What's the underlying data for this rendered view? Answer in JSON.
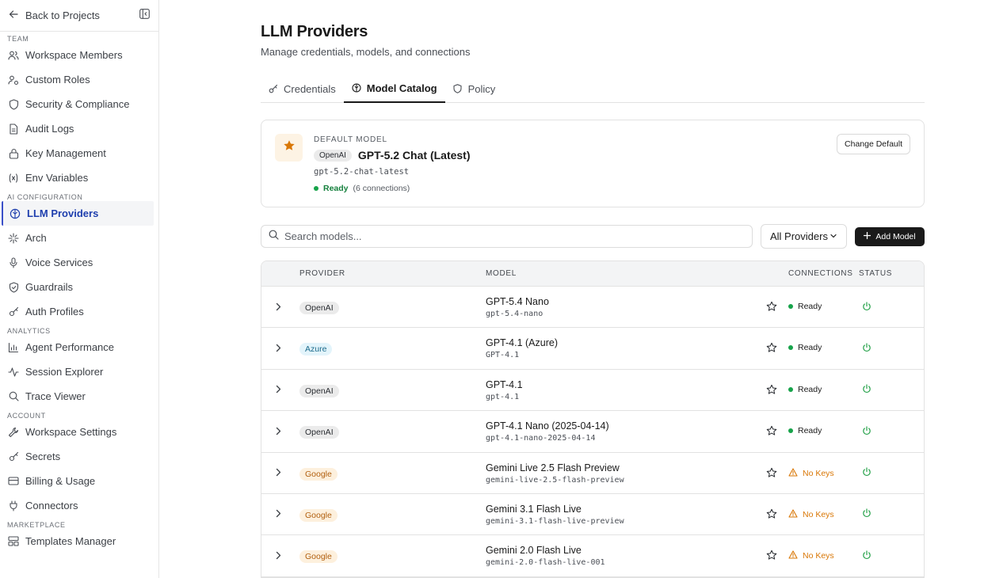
{
  "sidebar": {
    "back_label": "Back to Projects",
    "sections": [
      {
        "title": "TEAM",
        "items": [
          {
            "label": "Workspace Members",
            "icon": "users-icon"
          },
          {
            "label": "Custom Roles",
            "icon": "user-roles-icon"
          },
          {
            "label": "Security & Compliance",
            "icon": "shield-icon"
          },
          {
            "label": "Audit Logs",
            "icon": "document-icon"
          },
          {
            "label": "Key Management",
            "icon": "lock-icon"
          },
          {
            "label": "Env Variables",
            "icon": "variable-icon"
          }
        ]
      },
      {
        "title": "AI CONFIGURATION",
        "items": [
          {
            "label": "LLM Providers",
            "icon": "brain-icon",
            "active": true
          },
          {
            "label": "Arch",
            "icon": "network-icon"
          },
          {
            "label": "Voice Services",
            "icon": "microphone-icon"
          },
          {
            "label": "Guardrails",
            "icon": "shield-check-icon"
          },
          {
            "label": "Auth Profiles",
            "icon": "key-icon"
          }
        ]
      },
      {
        "title": "ANALYTICS",
        "items": [
          {
            "label": "Agent Performance",
            "icon": "bar-chart-icon"
          },
          {
            "label": "Session Explorer",
            "icon": "activity-icon"
          },
          {
            "label": "Trace Viewer",
            "icon": "search-icon"
          }
        ]
      },
      {
        "title": "ACCOUNT",
        "items": [
          {
            "label": "Workspace Settings",
            "icon": "wrench-icon"
          },
          {
            "label": "Secrets",
            "icon": "key-icon"
          },
          {
            "label": "Billing & Usage",
            "icon": "credit-card-icon"
          },
          {
            "label": "Connectors",
            "icon": "plug-icon"
          }
        ]
      },
      {
        "title": "MARKETPLACE",
        "items": [
          {
            "label": "Templates Manager",
            "icon": "layout-icon"
          }
        ]
      }
    ]
  },
  "header": {
    "title": "LLM Providers",
    "subtitle": "Manage credentials, models, and connections"
  },
  "tabs": [
    {
      "label": "Credentials",
      "icon": "key-icon"
    },
    {
      "label": "Model Catalog",
      "icon": "brain-icon",
      "active": true
    },
    {
      "label": "Policy",
      "icon": "shield-icon"
    }
  ],
  "default_model": {
    "label": "DEFAULT MODEL",
    "provider": "OpenAI",
    "name": "GPT-5.2 Chat (Latest)",
    "id": "gpt-5.2-chat-latest",
    "status": "Ready",
    "connections": "(6 connections)",
    "change_label": "Change Default",
    "star_color": "#d97706"
  },
  "toolbar": {
    "search_placeholder": "Search models...",
    "provider_filter": "All Providers",
    "add_label": "Add Model"
  },
  "table": {
    "columns": {
      "provider": "PROVIDER",
      "model": "MODEL",
      "connections": "CONNECTIONS",
      "status": "STATUS"
    },
    "rows": [
      {
        "provider": "OpenAI",
        "kind": "openai",
        "name": "GPT-5.4 Nano",
        "id": "gpt-5.4-nano",
        "status": "Ready",
        "state": "ready"
      },
      {
        "provider": "Azure",
        "kind": "azure",
        "name": "GPT-4.1 (Azure)",
        "id": "GPT-4.1",
        "status": "Ready",
        "state": "ready"
      },
      {
        "provider": "OpenAI",
        "kind": "openai",
        "name": "GPT-4.1",
        "id": "gpt-4.1",
        "status": "Ready",
        "state": "ready"
      },
      {
        "provider": "OpenAI",
        "kind": "openai",
        "name": "GPT-4.1 Nano (2025-04-14)",
        "id": "gpt-4.1-nano-2025-04-14",
        "status": "Ready",
        "state": "ready"
      },
      {
        "provider": "Google",
        "kind": "google",
        "name": "Gemini Live 2.5 Flash Preview",
        "id": "gemini-live-2.5-flash-preview",
        "status": "No Keys",
        "state": "nokeys"
      },
      {
        "provider": "Google",
        "kind": "google",
        "name": "Gemini 3.1 Flash Live",
        "id": "gemini-3.1-flash-live-preview",
        "status": "No Keys",
        "state": "nokeys"
      },
      {
        "provider": "Google",
        "kind": "google",
        "name": "Gemini 2.0 Flash Live",
        "id": "gemini-2.0-flash-live-001",
        "status": "No Keys",
        "state": "nokeys"
      }
    ]
  },
  "colors": {
    "ready": "#17a34a",
    "warning": "#d97706",
    "power": "#22a047",
    "accent": "#3a4fc8"
  }
}
